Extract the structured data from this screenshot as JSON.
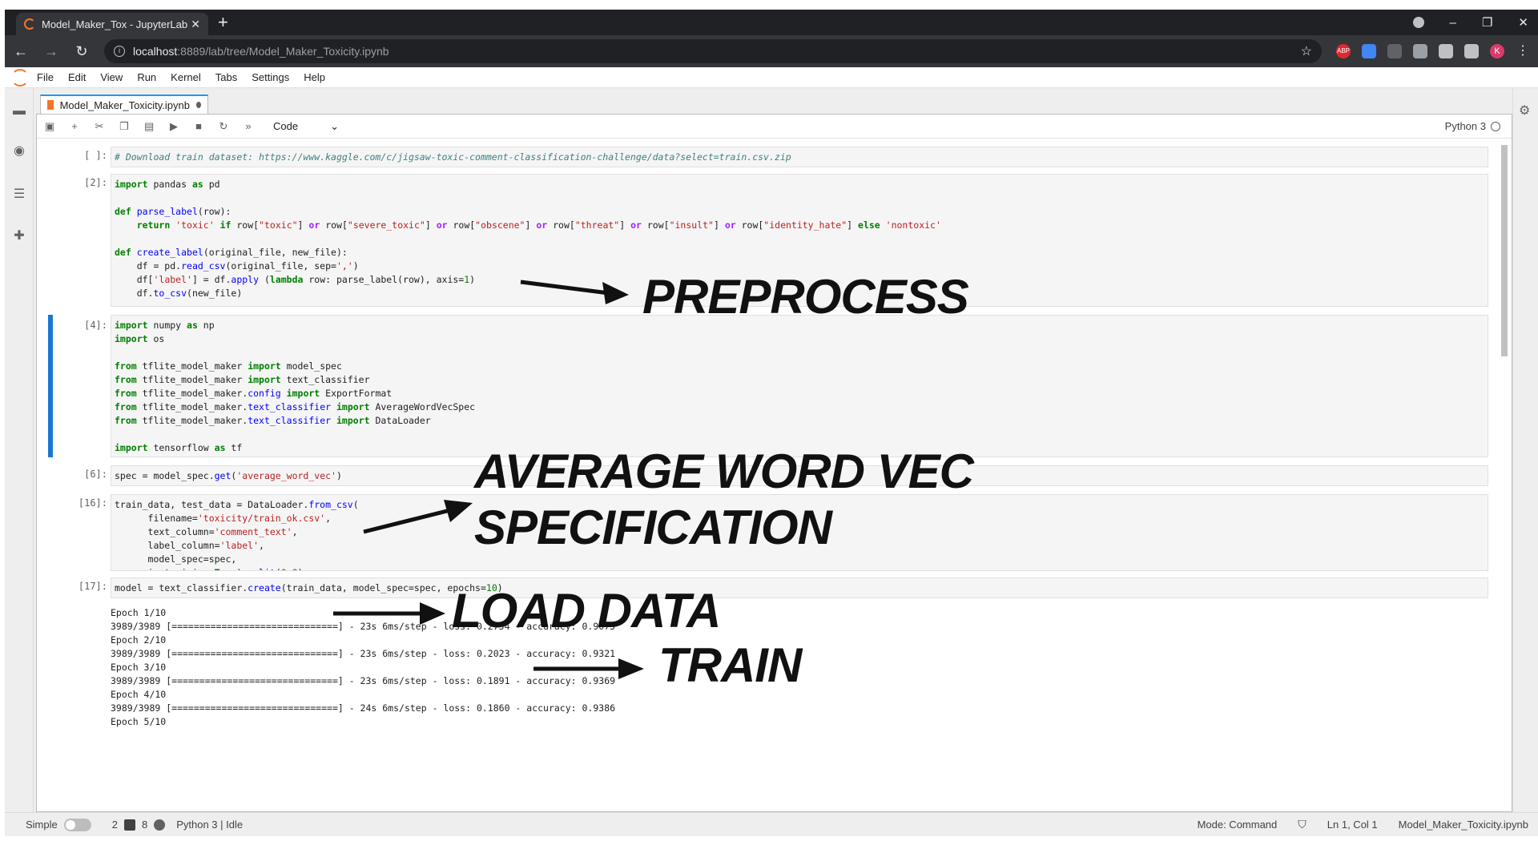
{
  "browser": {
    "tab_title": "Model_Maker_Tox - JupyterLab",
    "tab_close": "✕",
    "new_tab": "+",
    "url_host": "localhost",
    "url_path": ":8889/lab/tree/Model_Maker_Toxicity.ipynb",
    "avatar_letter": "K",
    "abp_label": "ABP"
  },
  "menubar": {
    "items": [
      "File",
      "Edit",
      "View",
      "Run",
      "Kernel",
      "Tabs",
      "Settings",
      "Help"
    ]
  },
  "notebook": {
    "tab_title": "Model_Maker_Toxicity.ipynb",
    "cell_type": "Code",
    "kernel_name": "Python 3"
  },
  "cells": [
    {
      "prompt": "[ ]:"
    },
    {
      "prompt": "[2]:"
    },
    {
      "prompt": "[4]:"
    },
    {
      "prompt": "[6]:"
    },
    {
      "prompt": "[16]:"
    },
    {
      "prompt": "[17]:"
    }
  ],
  "output_lines": [
    "Epoch 1/10",
    "3989/3989 [==============================] - 23s 6ms/step - loss: 0.2754 - accuracy: 0.9075",
    "Epoch 2/10",
    "3989/3989 [==============================] - 23s 6ms/step - loss: 0.2023 - accuracy: 0.9321",
    "Epoch 3/10",
    "3989/3989 [==============================] - 23s 6ms/step - loss: 0.1891 - accuracy: 0.9369",
    "Epoch 4/10",
    "3989/3989 [==============================] - 24s 6ms/step - loss: 0.1860 - accuracy: 0.9386",
    "Epoch 5/10"
  ],
  "annotations": {
    "preprocess": "PREPROCESS",
    "avg_line1": "AVERAGE WORD VEC",
    "avg_line2": "SPECIFICATION",
    "load_data": "LOAD DATA",
    "train": "TRAIN"
  },
  "statusbar": {
    "simple_label": "Simple",
    "terminals_count": "2",
    "kernels_count": "8",
    "kernel_status": "Python 3 | Idle",
    "mode": "Mode: Command",
    "cursor": "Ln 1, Col 1",
    "filename": "Model_Maker_Toxicity.ipynb"
  },
  "colors": {
    "jupyter_orange": "#f37626",
    "active_cell_bar": "#1976d2",
    "chrome_dark": "#202124"
  }
}
